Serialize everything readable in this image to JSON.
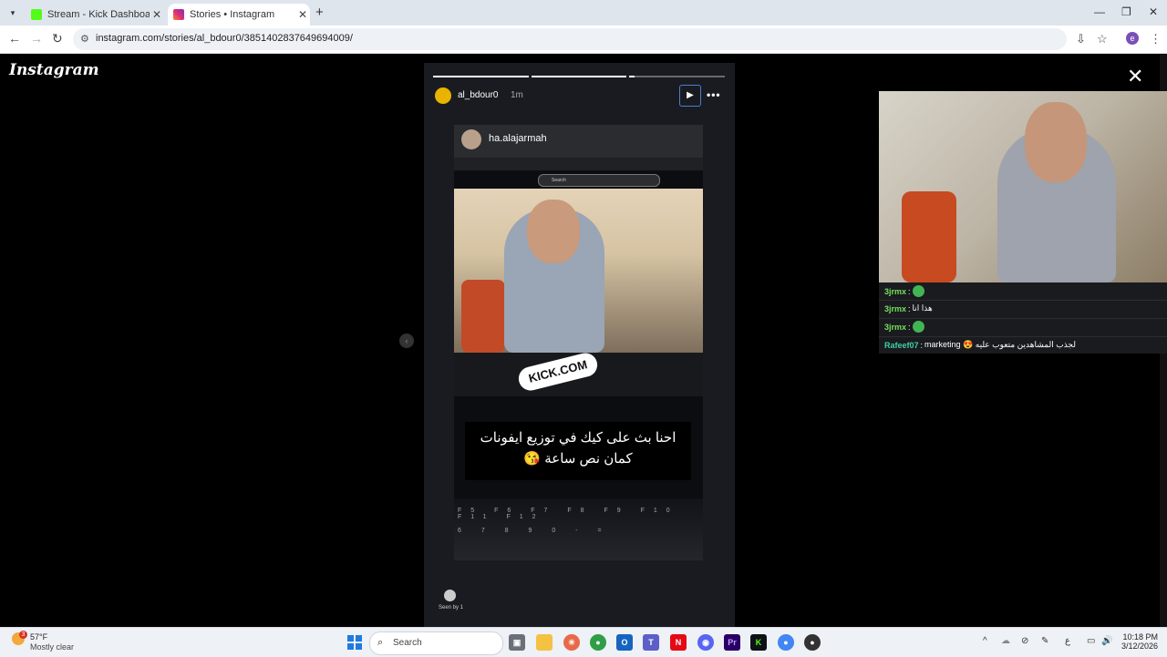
{
  "browser": {
    "tabs": [
      {
        "title": "Stream - Kick Dashboard",
        "active": false,
        "favicon_color": "#53fc18"
      },
      {
        "title": "Stories • Instagram",
        "active": true,
        "favicon_color": "#dd2a7b"
      }
    ],
    "url": "instagram.com/stories/al_bdour0/3851402837649694009/"
  },
  "instagram": {
    "logo": "Instagram",
    "story": {
      "username": "al_bdour0",
      "time": "1m",
      "progress": [
        1.0,
        1.0,
        0.05
      ],
      "seen": "Seen by 1",
      "media": {
        "inner_username": "ha.alajarmah",
        "search_placeholder": "Search",
        "sticker": "KICK.COM",
        "caption_line1": "احنا بث على كيك في توزيع ايفونات",
        "caption_line2": "كمان نص ساعة 😘",
        "keyboard_row1": "F5 F6 F7 F8 F9 F10 F11 F12",
        "keyboard_row2": "6 7 8 9 0 - ="
      }
    }
  },
  "stream_overlay": {
    "chat": [
      {
        "user": "3jrmx",
        "message": "",
        "emote": true,
        "user_color": "#74e05b"
      },
      {
        "user": "3jrmx",
        "message": "هذا انا",
        "emote": false,
        "user_color": "#74e05b"
      },
      {
        "user": "3jrmx",
        "message": "",
        "emote": true,
        "user_color": "#74e05b"
      },
      {
        "user": "Rafeef07",
        "message": "marketing 😍 لجذب المشاهدين متعوب عليه",
        "emote": false,
        "user_color": "#3fd0a0"
      }
    ]
  },
  "taskbar": {
    "weather_temp": "57°F",
    "weather_cond": "Mostly clear",
    "weather_badge": "3",
    "search_label": "Search",
    "time": "10:18 PM",
    "date": "3/12/2026"
  }
}
